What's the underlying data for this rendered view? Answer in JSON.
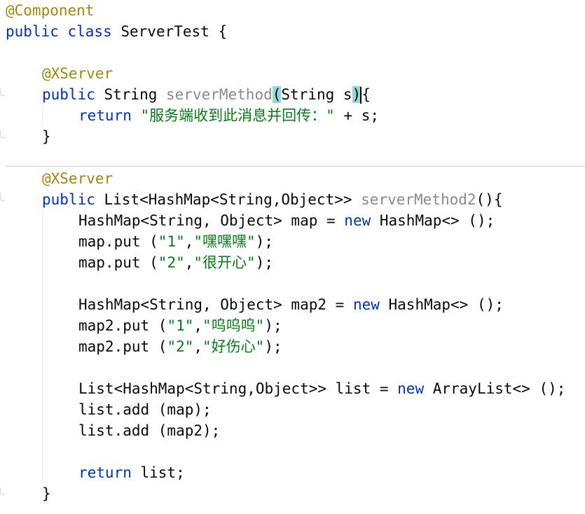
{
  "editor": {
    "lines": [
      {
        "indent": 0,
        "tokens": [
          {
            "t": "@Component",
            "c": "ann"
          }
        ]
      },
      {
        "indent": 0,
        "tokens": [
          {
            "t": "public",
            "c": "kw"
          },
          {
            "t": " ",
            "c": "plain"
          },
          {
            "t": "class",
            "c": "kw"
          },
          {
            "t": " ServerTest {",
            "c": "plain"
          }
        ]
      },
      {
        "indent": 0,
        "tokens": []
      },
      {
        "indent": 1,
        "tokens": [
          {
            "t": "@XServer",
            "c": "ann"
          }
        ]
      },
      {
        "indent": 1,
        "tokens": [
          {
            "t": "public",
            "c": "kw"
          },
          {
            "t": " String ",
            "c": "plain"
          },
          {
            "t": "serverMethod",
            "c": "mdecl"
          },
          {
            "t": "(",
            "c": "match"
          },
          {
            "t": "String s",
            "c": "plain"
          },
          {
            "t": ")",
            "c": "match"
          },
          {
            "t": "",
            "c": "caret"
          },
          {
            "t": "{",
            "c": "plain"
          }
        ]
      },
      {
        "indent": 2,
        "tokens": [
          {
            "t": "return",
            "c": "kw"
          },
          {
            "t": " ",
            "c": "plain"
          },
          {
            "t": "\"服务端收到此消息并回传：\"",
            "c": "str"
          },
          {
            "t": " + s;",
            "c": "plain"
          }
        ]
      },
      {
        "indent": 1,
        "tokens": [
          {
            "t": "}",
            "c": "plain"
          }
        ]
      },
      {
        "indent": 0,
        "tokens": []
      },
      {
        "indent": 1,
        "tokens": [
          {
            "t": "@XServer",
            "c": "ann"
          }
        ]
      },
      {
        "indent": 1,
        "tokens": [
          {
            "t": "public",
            "c": "kw"
          },
          {
            "t": " List<HashMap<String,Object>> ",
            "c": "plain"
          },
          {
            "t": "serverMethod2",
            "c": "mdecl"
          },
          {
            "t": "(){",
            "c": "plain"
          }
        ]
      },
      {
        "indent": 2,
        "tokens": [
          {
            "t": "HashMap<String, Object> map = ",
            "c": "plain"
          },
          {
            "t": "new",
            "c": "kw"
          },
          {
            "t": " HashMap<> ();",
            "c": "plain"
          }
        ]
      },
      {
        "indent": 2,
        "tokens": [
          {
            "t": "map.put (",
            "c": "plain"
          },
          {
            "t": "\"1\"",
            "c": "str"
          },
          {
            "t": ",",
            "c": "plain"
          },
          {
            "t": "\"嘿嘿嘿\"",
            "c": "str"
          },
          {
            "t": ");",
            "c": "plain"
          }
        ]
      },
      {
        "indent": 2,
        "tokens": [
          {
            "t": "map.put (",
            "c": "plain"
          },
          {
            "t": "\"2\"",
            "c": "str"
          },
          {
            "t": ",",
            "c": "plain"
          },
          {
            "t": "\"很开心\"",
            "c": "str"
          },
          {
            "t": ");",
            "c": "plain"
          }
        ]
      },
      {
        "indent": 0,
        "tokens": []
      },
      {
        "indent": 2,
        "tokens": [
          {
            "t": "HashMap<String, Object> map2 = ",
            "c": "plain"
          },
          {
            "t": "new",
            "c": "kw"
          },
          {
            "t": " HashMap<> ();",
            "c": "plain"
          }
        ]
      },
      {
        "indent": 2,
        "tokens": [
          {
            "t": "map2.put (",
            "c": "plain"
          },
          {
            "t": "\"1\"",
            "c": "str"
          },
          {
            "t": ",",
            "c": "plain"
          },
          {
            "t": "\"呜呜呜\"",
            "c": "str"
          },
          {
            "t": ");",
            "c": "plain"
          }
        ]
      },
      {
        "indent": 2,
        "tokens": [
          {
            "t": "map2.put (",
            "c": "plain"
          },
          {
            "t": "\"2\"",
            "c": "str"
          },
          {
            "t": ",",
            "c": "plain"
          },
          {
            "t": "\"好伤心\"",
            "c": "str"
          },
          {
            "t": ");",
            "c": "plain"
          }
        ]
      },
      {
        "indent": 0,
        "tokens": []
      },
      {
        "indent": 2,
        "tokens": [
          {
            "t": "List<HashMap<String,Object>> list = ",
            "c": "plain"
          },
          {
            "t": "new",
            "c": "kw"
          },
          {
            "t": " ArrayList<> ();",
            "c": "plain"
          }
        ]
      },
      {
        "indent": 2,
        "tokens": [
          {
            "t": "list.add (map);",
            "c": "plain"
          }
        ]
      },
      {
        "indent": 2,
        "tokens": [
          {
            "t": "list.add (map2);",
            "c": "plain"
          }
        ]
      },
      {
        "indent": 0,
        "tokens": []
      },
      {
        "indent": 2,
        "tokens": [
          {
            "t": "return",
            "c": "kw"
          },
          {
            "t": " list;",
            "c": "plain"
          }
        ]
      },
      {
        "indent": 1,
        "tokens": [
          {
            "t": "}",
            "c": "plain"
          }
        ]
      }
    ]
  },
  "colors": {
    "keyword": "#0033b3",
    "annotation": "#9e880d",
    "string": "#067d17",
    "method_declaration": "#8a8a8a",
    "text": "#080808",
    "brace_match_highlight": "#93d9d9",
    "background": "#ffffff"
  }
}
